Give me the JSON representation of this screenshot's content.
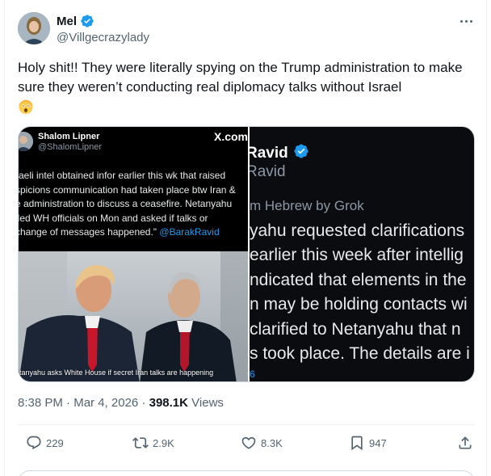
{
  "author": {
    "display_name": "Mel",
    "handle": "@Villgecrazylady",
    "verified": true
  },
  "tweet": {
    "text": "Holy shit!! They were literally spying on the Trump administration to make sure they weren’t conducting real diplomacy talks without Israel",
    "emoji": "astonished-face"
  },
  "media_left": {
    "author_name": "Shalom Lipner",
    "author_handle": "@ShalomLipner",
    "platform_mark": "X.com",
    "lines": [
      "raeli intel obtained infor earlier this wk that raised",
      "spicions communication had taken place btw Iran &",
      "e administration to discuss a ceasefire. Netanyahu",
      "lled WH officials on Mon and asked if talks or",
      "change of messages happened.\""
    ],
    "mention": "@BarakRavid",
    "caption": "etanyahu asks White House if secret Iran talks are happening"
  },
  "media_right": {
    "name": "Ravid",
    "handle": "Ravid",
    "translated": "m Hebrew by Grok",
    "lines": [
      "yahu requested clarifications",
      "earlier this week after intellig",
      "ndicated that elements in the",
      "n may be holding contacts wi",
      "clarified to Netanyahu that n",
      "s took place. The details are i"
    ],
    "tiny": "6"
  },
  "meta": {
    "time": "8:38 PM",
    "date": "Mar 4, 2026",
    "views_count": "398.1K",
    "views_label": "Views"
  },
  "actions": {
    "replies": "229",
    "reposts": "2.9K",
    "likes": "8.3K",
    "bookmarks": "947"
  },
  "colors": {
    "text": "#0f1419",
    "secondary": "#536471",
    "verified": "#1d9bf0",
    "border": "#cfd9de"
  }
}
